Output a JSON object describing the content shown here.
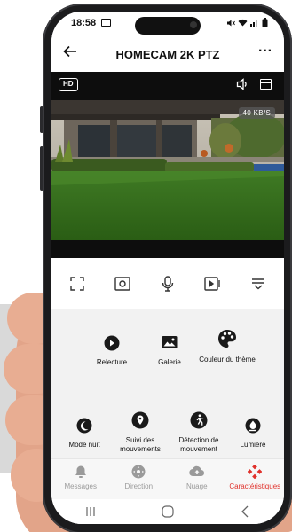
{
  "status_bar": {
    "time": "18:58"
  },
  "header": {
    "title": "HOMECAM 2K PTZ",
    "back_icon": "back-arrow-icon",
    "more_icon": "more-dots-icon",
    "more_glyph": "···"
  },
  "video": {
    "quality_badge": "HD",
    "bitrate": "40 KB/S"
  },
  "controls": [
    {
      "name": "fullscreen-icon"
    },
    {
      "name": "snapshot-icon"
    },
    {
      "name": "microphone-icon"
    },
    {
      "name": "record-icon"
    },
    {
      "name": "expand-menu-icon"
    }
  ],
  "features": {
    "replay": "Relecture",
    "gallery": "Galerie",
    "theme_color": "Couleur du thème",
    "night_mode": "Mode nuit",
    "motion_tracking": "Suivi des mouvements",
    "motion_detection": "Détection de mouvement",
    "light": "Lumière"
  },
  "tabs": [
    {
      "label": "Messages",
      "icon": "bell-icon"
    },
    {
      "label": "Direction",
      "icon": "joystick-icon"
    },
    {
      "label": "Nuage",
      "icon": "cloud-upload-icon"
    },
    {
      "label": "Caractéristiques",
      "icon": "features-diamond-icon",
      "active": true
    }
  ],
  "colors": {
    "accent": "#e0312b",
    "icon_dark": "#1a1a1a",
    "tab_inactive": "#9a9a9a",
    "feature_bg": "#f2f2f2"
  }
}
